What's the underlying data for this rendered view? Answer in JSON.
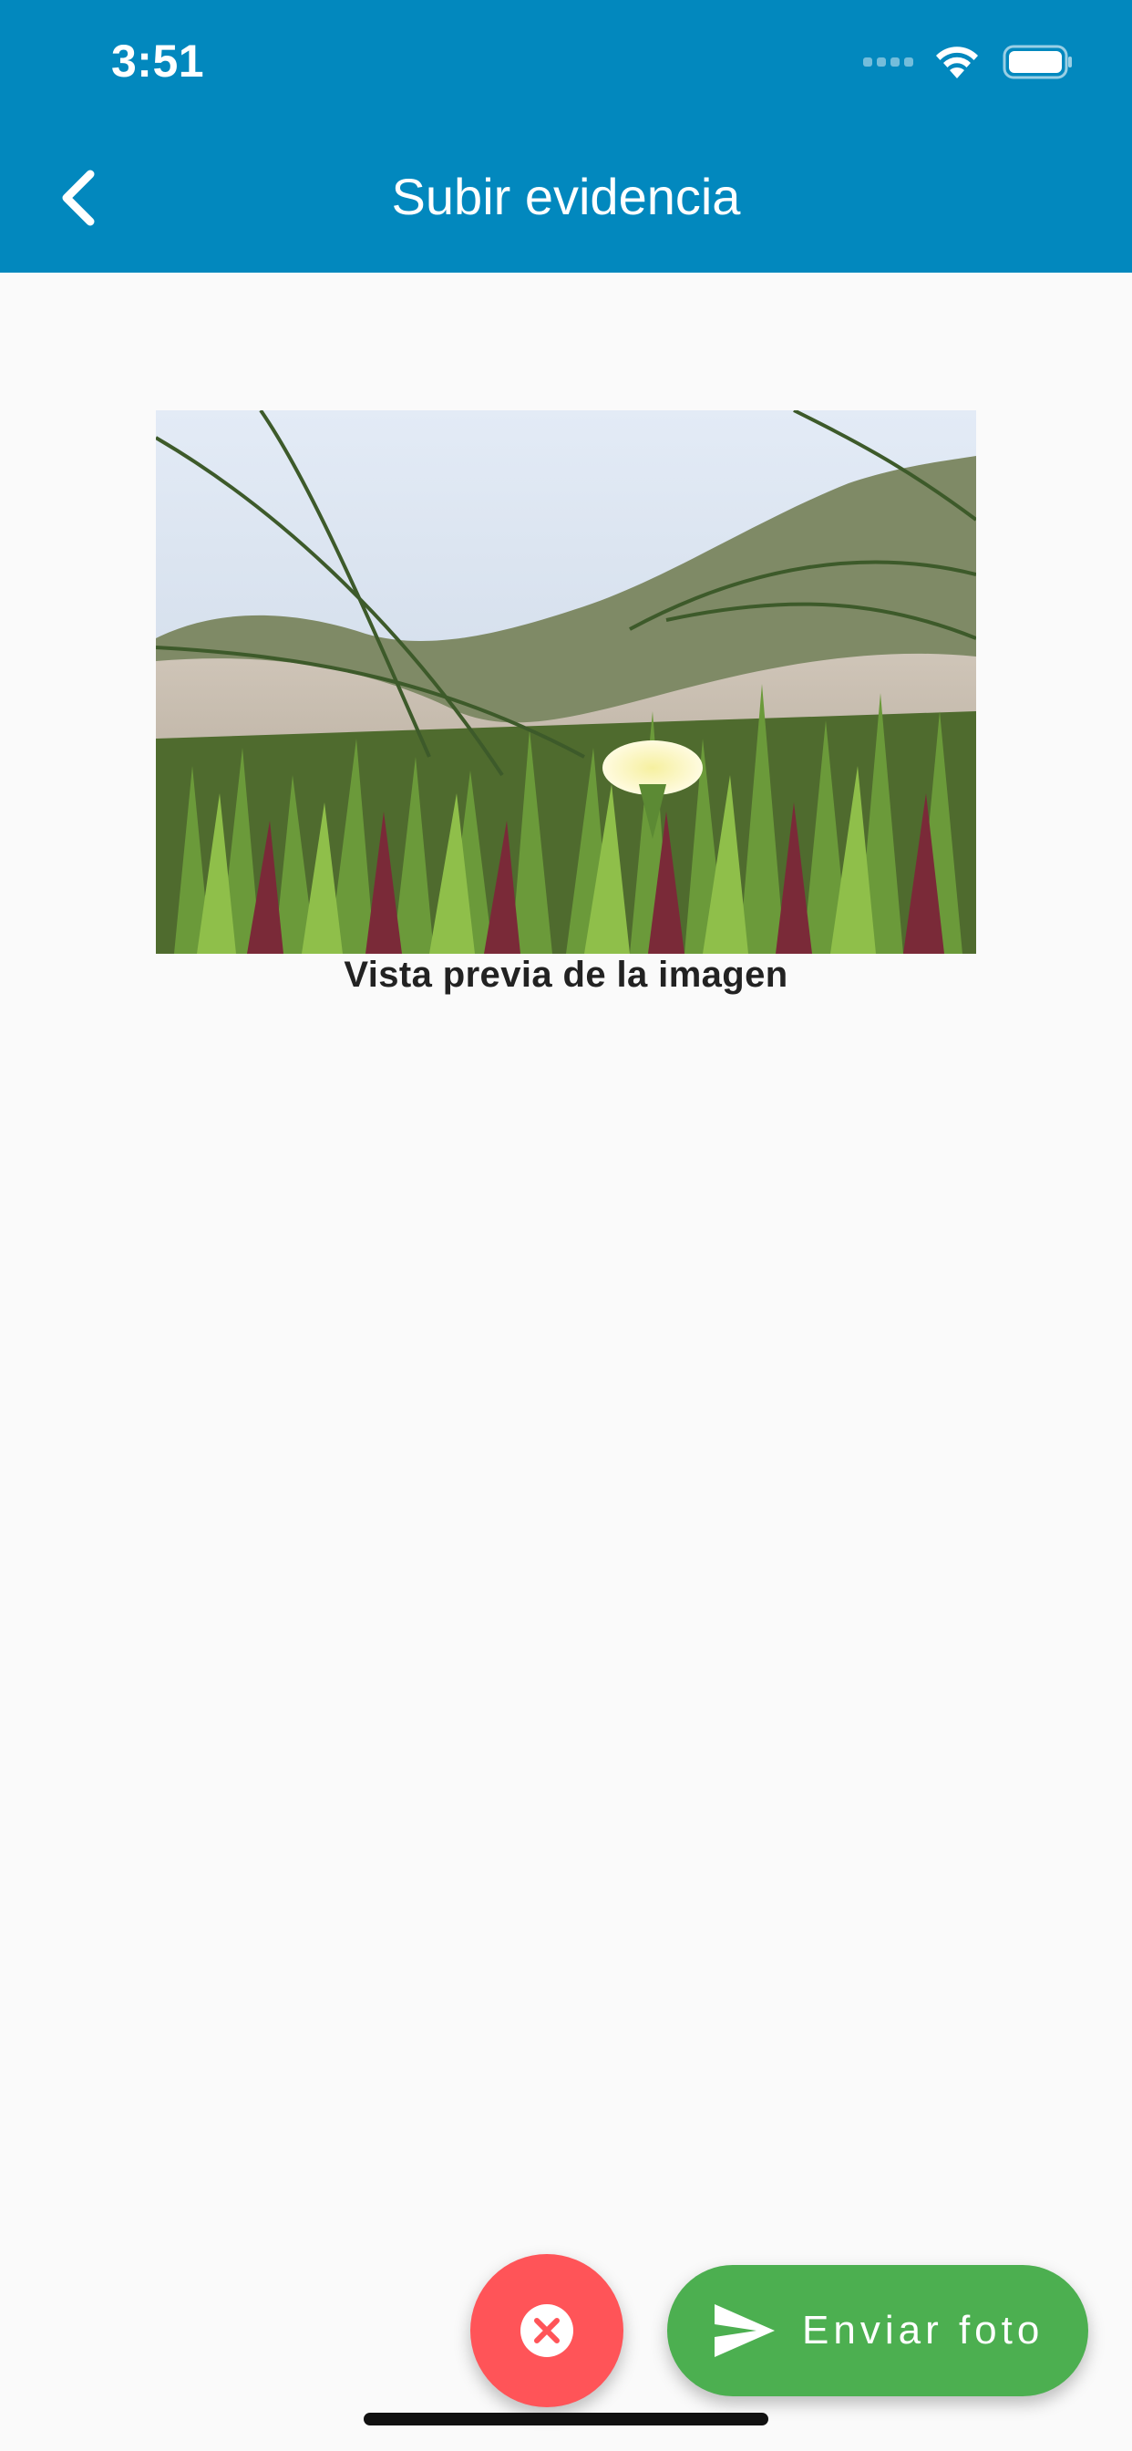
{
  "status_bar": {
    "time": "3:51"
  },
  "header": {
    "title": "Subir evidencia",
    "background_color": "#0288be"
  },
  "preview": {
    "caption": "Vista previa de la imagen"
  },
  "actions": {
    "send_label": "Enviar foto",
    "send_color": "#4caf50",
    "cancel_color": "#ff5458"
  },
  "icons": {
    "back": "chevron-left-icon",
    "cancel": "close-circle-icon",
    "send": "send-icon",
    "wifi": "wifi-icon",
    "battery": "battery-icon"
  }
}
